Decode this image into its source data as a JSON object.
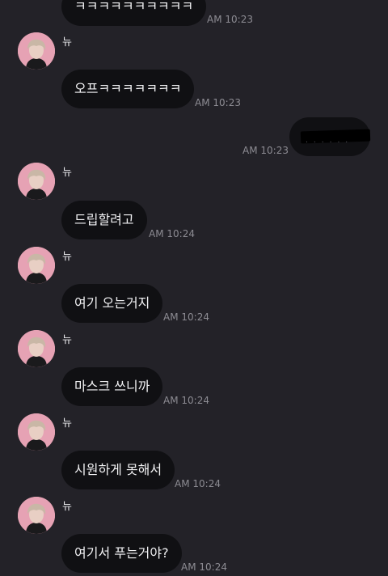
{
  "messages": [
    {
      "text": "ㅋㅋㅋㅋㅋㅋㅋㅋㅋㅋ",
      "time": "AM 10:23"
    },
    {
      "sender": "뉴",
      "text": "오프ㅋㅋㅋㅋㅋㅋㅋ",
      "time": "AM 10:23"
    },
    {
      "text": "......",
      "time": "AM 10:23"
    },
    {
      "sender": "뉴",
      "text": "드립할려고",
      "time": "AM 10:24"
    },
    {
      "sender": "뉴",
      "text": "여기 오는거지",
      "time": "AM 10:24"
    },
    {
      "sender": "뉴",
      "text": "마스크 쓰니까",
      "time": "AM 10:24"
    },
    {
      "sender": "뉴",
      "text": "시원하게 못해서",
      "time": "AM 10:24"
    },
    {
      "sender": "뉴",
      "text": "여기서 푸는거야?",
      "time": "AM 10:24"
    }
  ],
  "colors": {
    "background": "#232228",
    "bubble": "#101013",
    "bubble_text": "#f2f2f4",
    "timestamp": "#8d8c93",
    "avatar_bg": "#e6a2b4"
  },
  "icons": {
    "avatar": "profile-photo",
    "redaction": "redacted-text-mark"
  }
}
